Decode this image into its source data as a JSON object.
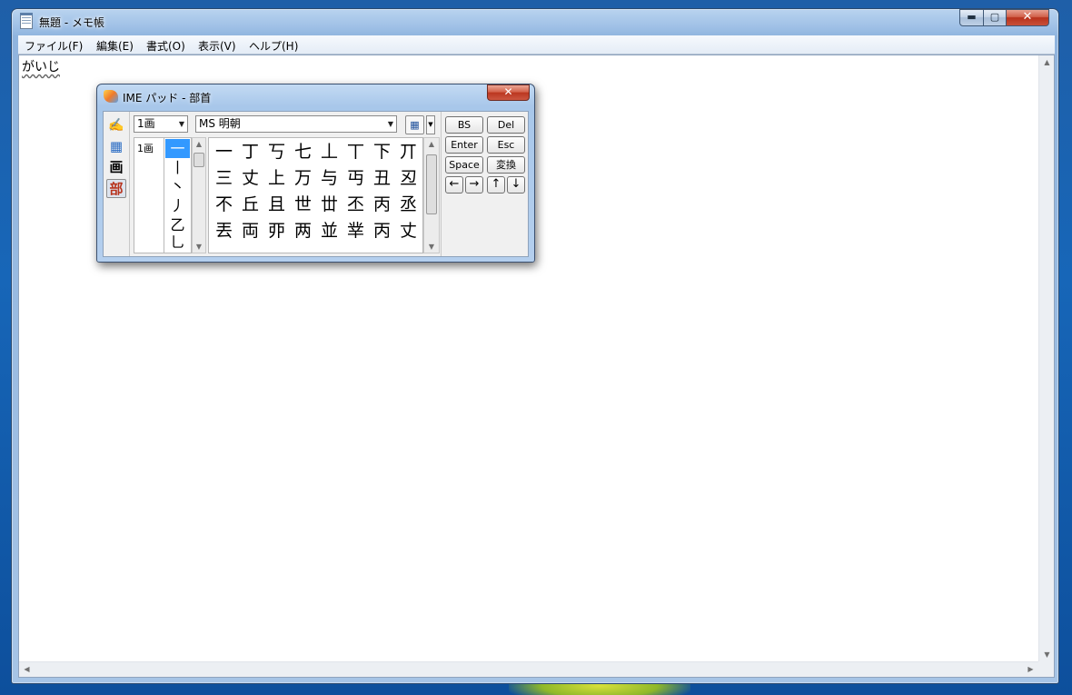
{
  "window": {
    "title": "無題 - メモ帳",
    "controls": {
      "minimize": "▬",
      "maximize": "▢",
      "close": "✕"
    }
  },
  "menu": [
    "ファイル(F)",
    "編集(E)",
    "書式(O)",
    "表示(V)",
    "ヘルプ(H)"
  ],
  "editor": {
    "text": "がいじ"
  },
  "ime_pad": {
    "title": "IME パッド - 部首",
    "close": "✕",
    "tools": {
      "handwriting": "✍",
      "list": "▦",
      "stroke": "画",
      "radical": "部"
    },
    "stroke_select": "1画",
    "font_select": "MS 明朝",
    "stroke_list": [
      "1画"
    ],
    "radicals": [
      "一",
      "丨",
      "丶",
      "丿",
      "乙",
      "乚"
    ],
    "selected_radical": 0,
    "characters": [
      [
        "一",
        "丁",
        "丂",
        "七",
        "丄",
        "丅",
        "下",
        "丌"
      ],
      [
        "三",
        "丈",
        "上",
        "万",
        "与",
        "丏",
        "丑",
        "丒"
      ],
      [
        "不",
        "丘",
        "且",
        "世",
        "丗",
        "丕",
        "丙",
        "丞"
      ],
      [
        "丟",
        "両",
        "丣",
        "两",
        "並",
        "丵",
        "丙",
        "丈"
      ]
    ],
    "keys": {
      "bs": "BS",
      "del": "Del",
      "enter": "Enter",
      "esc": "Esc",
      "space": "Space",
      "convert": "変換",
      "left": "←",
      "right": "→",
      "up": "↑",
      "down": "↓"
    }
  }
}
